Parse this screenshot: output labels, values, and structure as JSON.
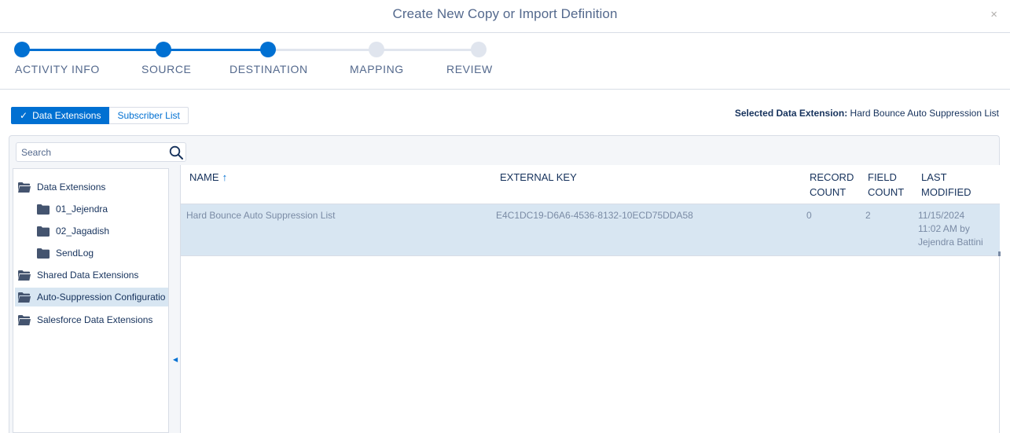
{
  "modal": {
    "title": "Create New Copy or Import Definition",
    "close_glyph": "×"
  },
  "steps": [
    {
      "label": "ACTIVITY INFO",
      "state": "done"
    },
    {
      "label": "SOURCE",
      "state": "done"
    },
    {
      "label": "DESTINATION",
      "state": "current"
    },
    {
      "label": "MAPPING",
      "state": "todo"
    },
    {
      "label": "REVIEW",
      "state": "todo"
    }
  ],
  "toggle": {
    "data_extensions": "Data Extensions",
    "subscriber_list": "Subscriber List"
  },
  "selected": {
    "label": "Selected Data Extension:",
    "value": "Hard Bounce Auto Suppression List"
  },
  "search": {
    "placeholder": "Search"
  },
  "tree": {
    "items": [
      {
        "label": "Data Extensions",
        "icon": "folder-open-icon"
      },
      {
        "label": "01_Jejendra",
        "icon": "folder-icon"
      },
      {
        "label": "02_Jagadish",
        "icon": "folder-icon"
      },
      {
        "label": "SendLog",
        "icon": "folder-icon"
      },
      {
        "label": "Shared Data Extensions",
        "icon": "folder-open-icon"
      },
      {
        "label": "Auto-Suppression Configuratio",
        "icon": "folder-open-icon",
        "selected": true
      },
      {
        "label": "Salesforce Data Extensions",
        "icon": "folder-open-icon"
      }
    ]
  },
  "table": {
    "headers": {
      "name": "NAME",
      "sort_glyph": "↑",
      "external_key": "EXTERNAL KEY",
      "record_count_1": "RECORD",
      "record_count_2": "COUNT",
      "field_count_1": "FIELD",
      "field_count_2": "COUNT",
      "last_modified_1": "LAST",
      "last_modified_2": "MODIFIED"
    },
    "rows": [
      {
        "name": "Hard Bounce Auto Suppression List",
        "external_key": "E4C1DC19-D6A6-4536-8132-10ECD75DDA58",
        "record_count": "0",
        "field_count": "2",
        "modified_1": "11/15/2024",
        "modified_2": "11:02 AM by",
        "modified_3": "Jejendra Battini"
      }
    ]
  },
  "colors": {
    "accent": "#0070d2",
    "selected_row": "#d8e6f2",
    "step_todo": "#e0e5ee"
  }
}
